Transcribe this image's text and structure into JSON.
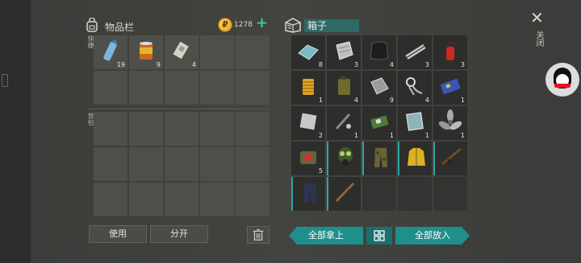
{
  "inventory": {
    "title": "物品栏",
    "coins": "1278",
    "quick_label": "快捷",
    "backpack_label": "背包",
    "quick_slots": [
      {
        "icon": "water-bottle-icon",
        "count": "19"
      },
      {
        "icon": "canned-food-icon",
        "count": "9"
      },
      {
        "icon": "bandage-icon",
        "count": "4"
      },
      {},
      {},
      {},
      {},
      {},
      {},
      {}
    ],
    "use_label": "使用",
    "split_label": "分开"
  },
  "box": {
    "name": "箱子",
    "take_all_label": "全部拿上",
    "put_all_label": "全部放入",
    "items": [
      {
        "icon": "glass-icon",
        "count": "8"
      },
      {
        "icon": "scrap-icon",
        "count": "3"
      },
      {
        "icon": "leather-icon",
        "count": "4"
      },
      {
        "icon": "pipes-icon",
        "count": "3"
      },
      {
        "icon": "fire-extinguisher-icon",
        "count": "3"
      },
      {
        "icon": "oil-filter-icon",
        "count": "1"
      },
      {
        "icon": "jerry-can-icon",
        "count": "4"
      },
      {
        "icon": "metal-plate-icon",
        "count": "9"
      },
      {
        "icon": "cables-icon",
        "count": "4"
      },
      {
        "icon": "circuit-board-icon",
        "count": "1"
      },
      {
        "icon": "steel-sheet-icon",
        "count": "2"
      },
      {
        "icon": "tools-icon",
        "count": "1"
      },
      {
        "icon": "electronics-icon",
        "count": "1"
      },
      {
        "icon": "mirror-icon",
        "count": "1"
      },
      {
        "icon": "propeller-icon",
        "count": "1"
      },
      {
        "icon": "medkit-bag-icon",
        "count": "5"
      },
      {
        "icon": "gas-mask-icon",
        "count": ""
      },
      {
        "icon": "camo-pants-icon",
        "count": ""
      },
      {
        "icon": "yellow-jacket-icon",
        "count": ""
      },
      {
        "icon": "rifle-icon",
        "count": ""
      },
      {
        "icon": "blue-pants-icon",
        "count": ""
      },
      {
        "icon": "shotgun-icon",
        "count": ""
      },
      {},
      {},
      {}
    ]
  },
  "close_label": "关闭",
  "colors": {
    "accent": "#1f8f8c",
    "coin": "#d69a1f",
    "plus": "#3fcf8e"
  }
}
